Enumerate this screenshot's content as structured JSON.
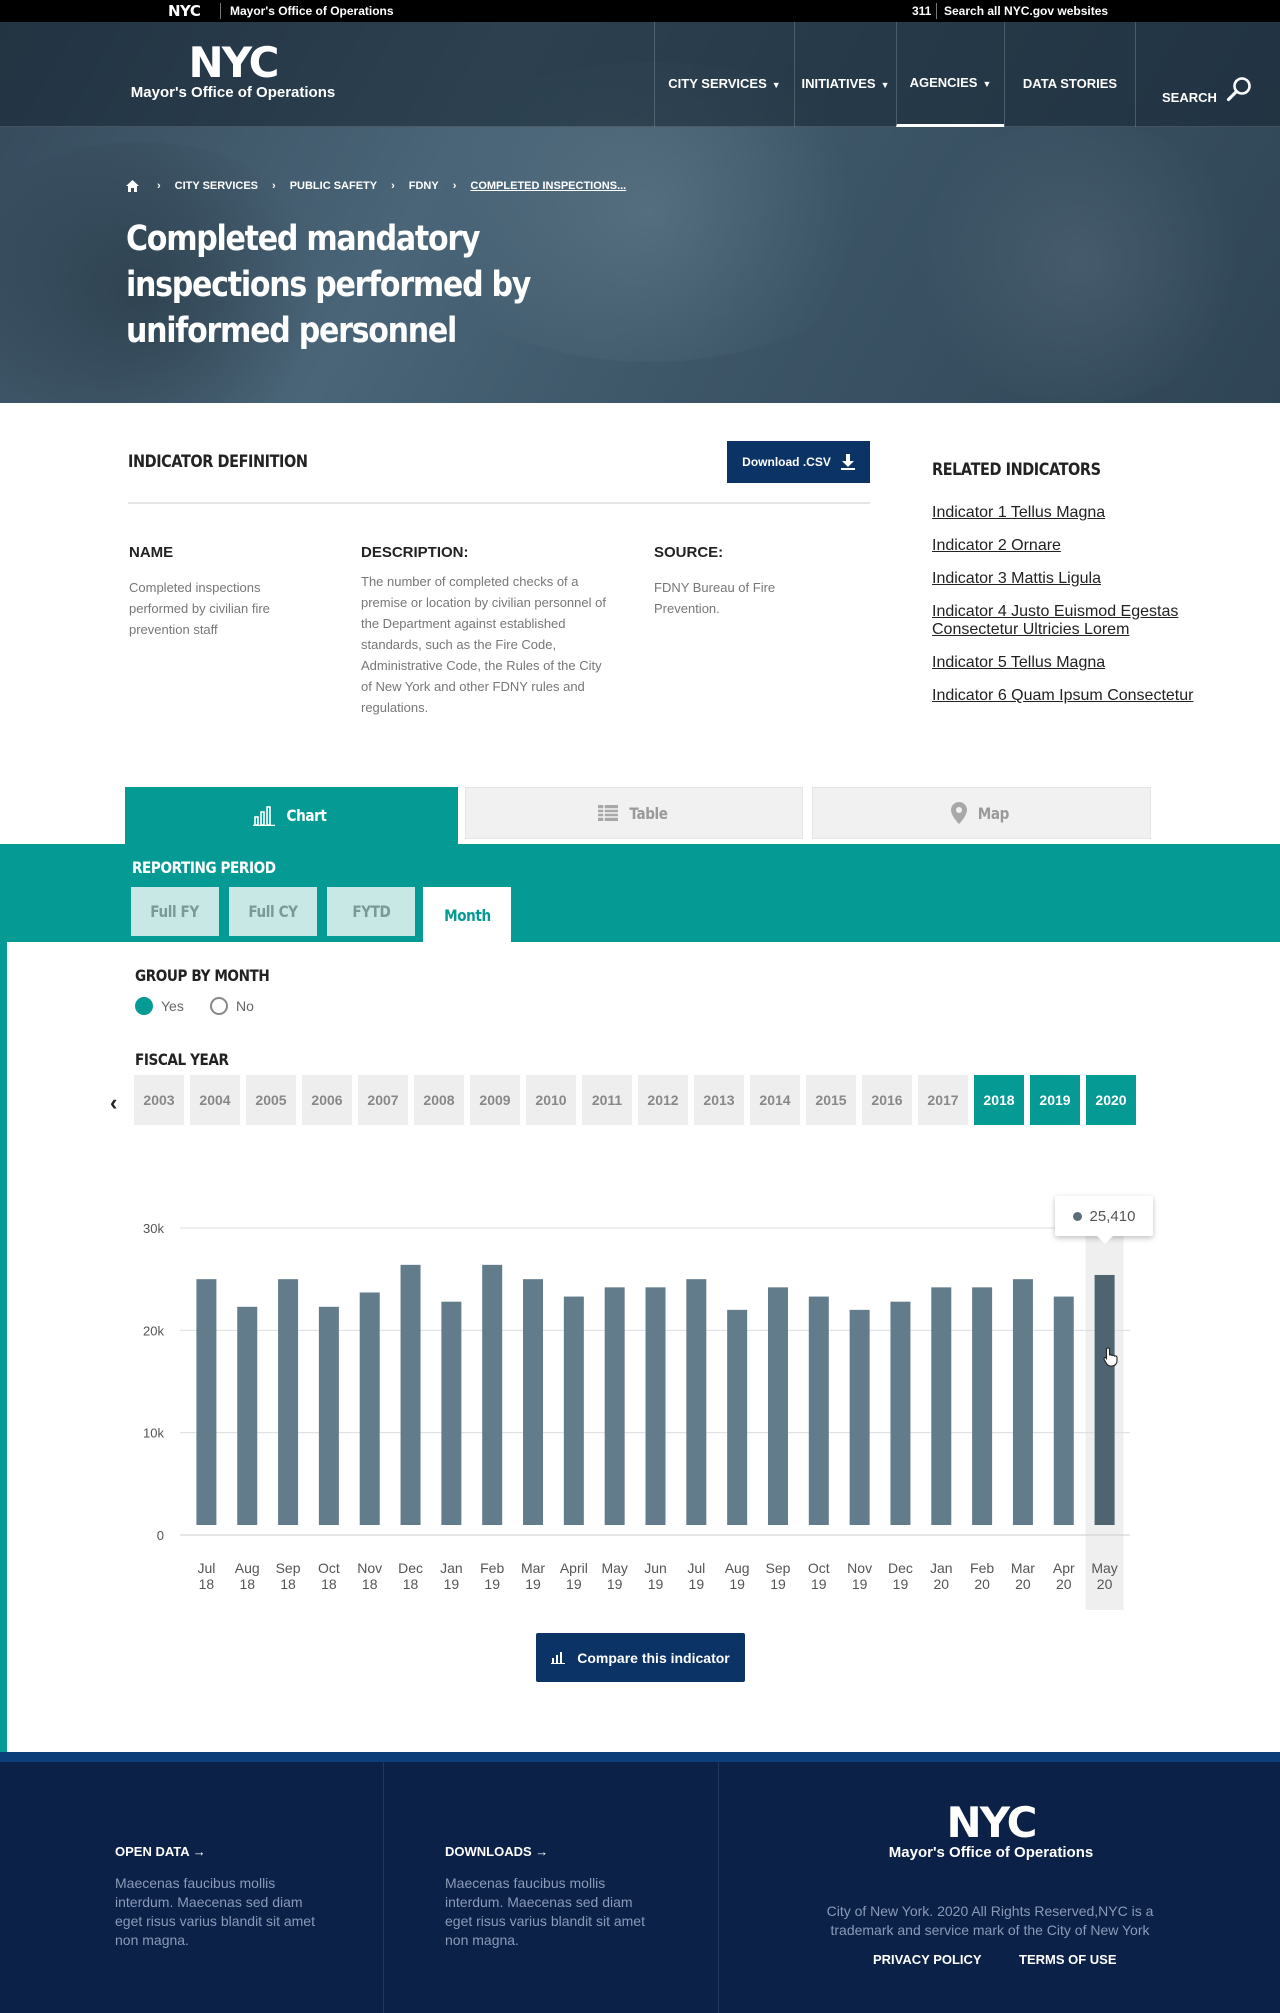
{
  "topbar": {
    "nyc": "NYC",
    "office": "Mayor's Office of Operations",
    "t311": "311",
    "search_all": "Search all NYC.gov websites"
  },
  "header": {
    "logo_big": "NYC",
    "logo_sub": "Mayor's Office of Operations",
    "nav": [
      {
        "label": "CITY SERVICES",
        "caret": "▼"
      },
      {
        "label": "INITIATIVES",
        "caret": "▼"
      },
      {
        "label": "AGENCIES",
        "caret": "▼"
      },
      {
        "label": "DATA STORIES"
      }
    ],
    "search_label": "SEARCH"
  },
  "breadcrumb": [
    "CITY SERVICES",
    "PUBLIC SAFETY",
    "FDNY",
    "COMPLETED INSPECTIONS..."
  ],
  "page_title": "Completed mandatory inspections performed by uniformed personnel",
  "definition": {
    "heading": "INDICATOR DEFINITION",
    "download_label": "Download .CSV",
    "name_head": "NAME",
    "name_text": "Completed inspections performed by civilian fire prevention staff",
    "desc_head": "DESCRIPTION:",
    "desc_text": "The number of completed checks of a premise or location by civilian personnel of the Department against established standards, such as the Fire Code, Administrative Code, the Rules of the City of New York and other FDNY rules and regulations.",
    "source_head": "SOURCE:",
    "source_text": "FDNY Bureau of Fire Prevention."
  },
  "related": {
    "heading": "RELATED INDICATORS",
    "links": [
      "Indicator 1 Tellus Magna",
      "Indicator 2 Ornare",
      "Indicator 3 Mattis Ligula",
      "Indicator 4 Justo Euismod Egestas Consectetur Ultricies Lorem",
      "Indicator 5 Tellus Magna",
      "Indicator 6 Quam Ipsum Consectetur"
    ]
  },
  "tabs": [
    "Chart",
    "Table",
    "Map"
  ],
  "reporting": {
    "heading": "REPORTING PERIOD",
    "periods": [
      "Full FY",
      "Full CY",
      "FYTD",
      "Month"
    ],
    "active": "Month"
  },
  "group_by": {
    "heading": "GROUP BY MONTH",
    "yes": "Yes",
    "no": "No",
    "selected": "Yes"
  },
  "fiscal_year": {
    "heading": "FISCAL YEAR",
    "years": [
      "2003",
      "2004",
      "2005",
      "2006",
      "2007",
      "2008",
      "2009",
      "2010",
      "2011",
      "2012",
      "2013",
      "2014",
      "2015",
      "2016",
      "2017",
      "2018",
      "2019",
      "2020"
    ],
    "selected": [
      "2018",
      "2019",
      "2020"
    ]
  },
  "chart_data": {
    "type": "bar",
    "categories": [
      "Jul 18",
      "Aug 18",
      "Sep 18",
      "Oct 18",
      "Nov 18",
      "Dec 18",
      "Jan 19",
      "Feb 19",
      "Mar 19",
      "April 19",
      "May 19",
      "Jun 19",
      "Jul 19",
      "Aug 19",
      "Sep 19",
      "Oct 19",
      "Nov 19",
      "Dec 19",
      "Jan 20",
      "Feb 20",
      "Mar 20",
      "Apr 20",
      "May 20"
    ],
    "values": [
      25000,
      22300,
      25000,
      22300,
      23700,
      26400,
      22800,
      26400,
      25000,
      23300,
      24200,
      24200,
      25000,
      22000,
      24200,
      23300,
      22000,
      22800,
      24200,
      24200,
      25000,
      23300,
      25410
    ],
    "ylim": [
      0,
      30000
    ],
    "yticks": [
      0,
      10000,
      20000,
      30000
    ],
    "ytick_labels": [
      "0",
      "10k",
      "20k",
      "30k"
    ],
    "grid": true,
    "highlighted_index": 22,
    "tooltip_value": "25,410",
    "bar_color": "#637c8c",
    "highlight_color": "#4e6470"
  },
  "compare_label": "Compare this indicator",
  "footer": {
    "open_data": "OPEN DATA →",
    "open_text": "Maecenas faucibus mollis interdum. Maecenas sed diam eget risus varius blandit sit amet non magna.",
    "downloads": "DOWNLOADS →",
    "downloads_text": "Maecenas faucibus mollis interdum. Maecenas sed diam eget risus varius blandit sit amet non magna.",
    "logo_big": "NYC",
    "logo_sub": "Mayor's Office of Operations",
    "copyright": "City of New York. 2020 All Rights Reserved,NYC is a trademark and service mark of the City of New York",
    "privacy": "PRIVACY POLICY",
    "terms": "TERMS OF USE"
  }
}
